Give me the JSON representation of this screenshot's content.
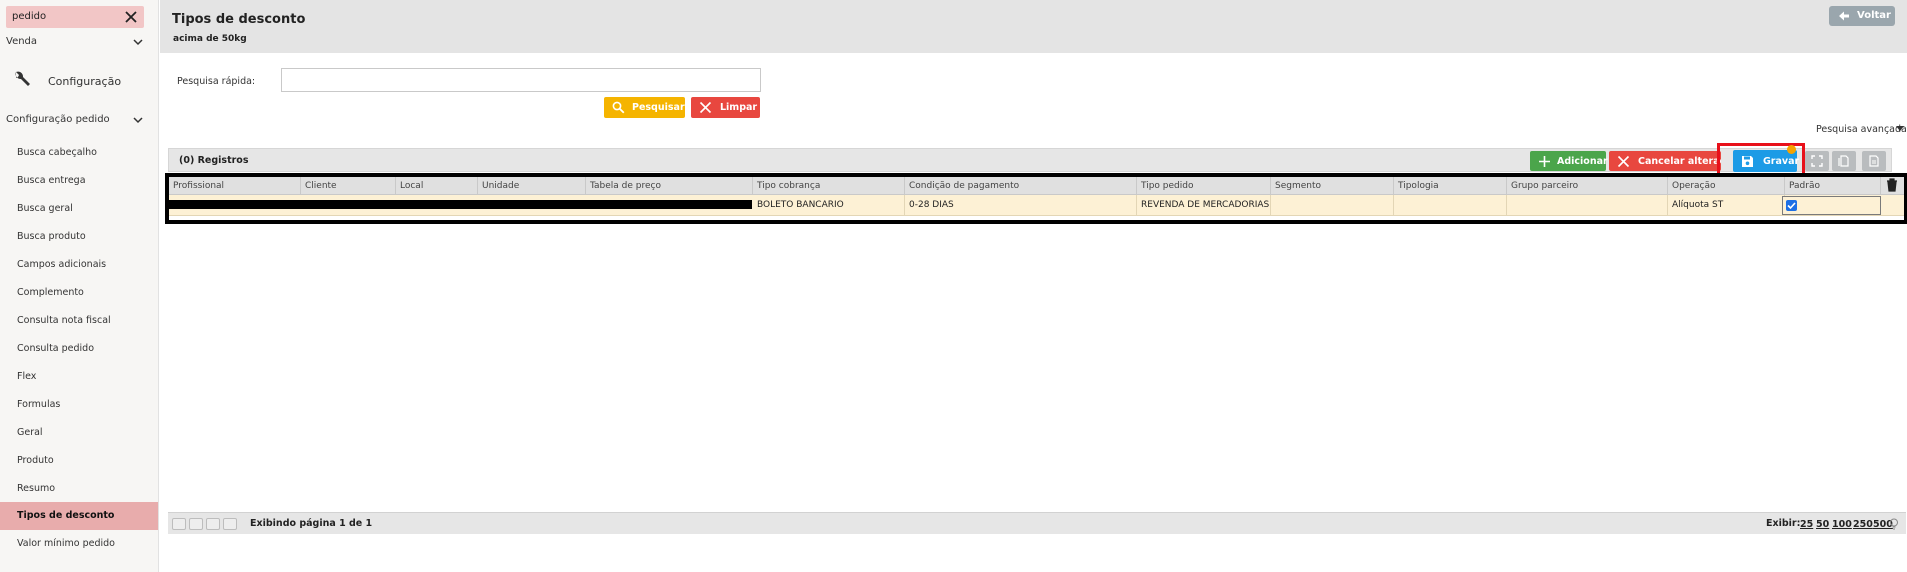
{
  "sidebar": {
    "search_value": "pedido",
    "group_venda": "Venda",
    "config_label": "Configuração",
    "group_config_pedido": "Configuração pedido",
    "items": [
      {
        "label": "Busca cabeçalho"
      },
      {
        "label": "Busca entrega"
      },
      {
        "label": "Busca geral"
      },
      {
        "label": "Busca produto"
      },
      {
        "label": "Campos adicionais"
      },
      {
        "label": "Complemento"
      },
      {
        "label": "Consulta nota fiscal"
      },
      {
        "label": "Consulta pedido"
      },
      {
        "label": "Flex"
      },
      {
        "label": "Formulas"
      },
      {
        "label": "Geral"
      },
      {
        "label": "Produto"
      },
      {
        "label": "Resumo"
      },
      {
        "label": "Tipos de desconto",
        "active": true
      },
      {
        "label": "Valor mínimo pedido"
      }
    ]
  },
  "header": {
    "title": "Tipos de desconto",
    "subtitle": "acima de 50kg",
    "back_label": "Voltar"
  },
  "quick_search": {
    "label": "Pesquisa rápida:",
    "value": "",
    "search_label": "Pesquisar",
    "clear_label": "Limpar",
    "advanced_label": "Pesquisa avançada"
  },
  "grid": {
    "records_label": "(0) Registros",
    "add_label": "Adicionar",
    "cancel_label": "Cancelar alteração",
    "save_label": "Gravar",
    "columns": [
      "Profissional",
      "Cliente",
      "Local",
      "Unidade",
      "Tabela de preço",
      "Tipo cobrança",
      "Condição de pagamento",
      "Tipo pedido",
      "Segmento",
      "Tipologia",
      "Grupo parceiro",
      "Operação",
      "Padrão"
    ],
    "row": {
      "tipo_cobranca": "BOLETO BANCARIO",
      "condicao_pagamento": "0-28 DIAS",
      "tipo_pedido": "REVENDA DE MERCADORIAS",
      "segmento": "",
      "tipologia": "",
      "grupo_parceiro": "",
      "operacao": "Alíquota ST",
      "padrao": true
    }
  },
  "pager": {
    "info": "Exibindo página 1 de 1",
    "show_label": "Exibir:",
    "sizes": [
      "25",
      "50",
      "100",
      "250",
      "500"
    ]
  },
  "colors": {
    "accent_save": "#1c9be6",
    "add": "#4ba54b",
    "danger": "#e8473f",
    "search": "#f5b400",
    "active_nav": "#e8acac",
    "row_selected": "#fdf1d5",
    "highlight_box": "#e8101a"
  }
}
